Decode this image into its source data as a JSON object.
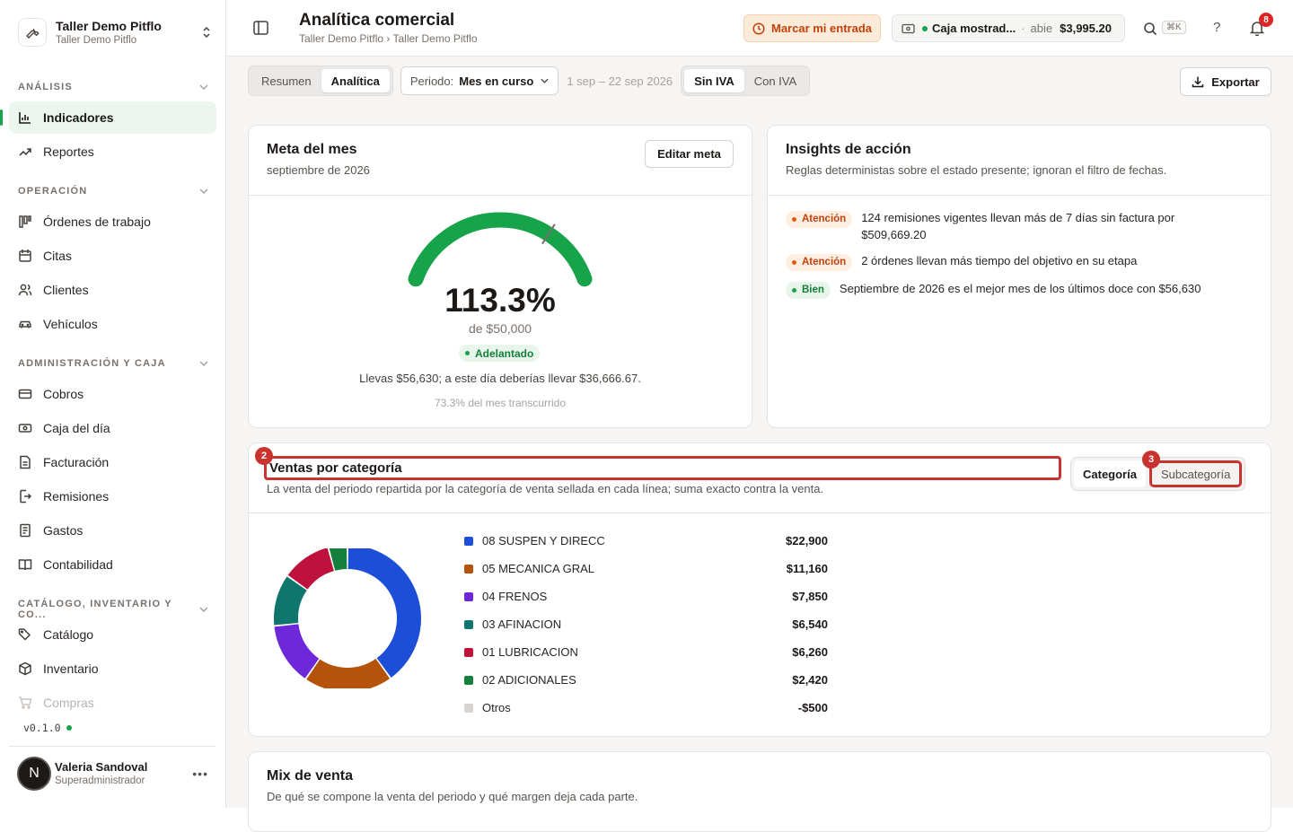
{
  "sidebar": {
    "org_name": "Taller Demo Pitflo",
    "org_sub": "Taller Demo Pitflo",
    "sections": {
      "analysis": "ANÁLISIS",
      "operation": "OPERACIÓN",
      "admin": "ADMINISTRACIÓN Y CAJA",
      "catalog": "CATÁLOGO, INVENTARIO Y CO..."
    },
    "items": {
      "indicadores": "Indicadores",
      "reportes": "Reportes",
      "ordenes": "Órdenes de trabajo",
      "citas": "Citas",
      "clientes": "Clientes",
      "vehiculos": "Vehículos",
      "cobros": "Cobros",
      "caja": "Caja del día",
      "facturacion": "Facturación",
      "remisiones": "Remisiones",
      "gastos": "Gastos",
      "contabilidad": "Contabilidad",
      "catalogo": "Catálogo",
      "inventario": "Inventario",
      "compras": "Compras"
    },
    "version": "v0.1.0",
    "user": {
      "initial": "N",
      "name": "Valeria Sandoval",
      "role": "Superadministrador"
    }
  },
  "header": {
    "title": "Analítica comercial",
    "breadcrumb": "Taller Demo Pitflo › Taller Demo Pitflo",
    "entry_button": "Marcar mi entrada",
    "cash": {
      "name": "Caja mostrad...",
      "sep": "·",
      "status": "abie",
      "amount": "$3,995.20"
    },
    "shortcut": "⌘K",
    "help": "?",
    "notifications": "8"
  },
  "toolbar": {
    "tabs": [
      "Resumen",
      "Analítica"
    ],
    "period_label": "Periodo:",
    "period_value": "Mes en curso",
    "date_range": "1 sep – 22 sep 2026",
    "tax_tabs": [
      "Sin IVA",
      "Con IVA"
    ],
    "export": "Exportar"
  },
  "goal": {
    "title": "Meta del mes",
    "subtitle": "septiembre de 2026",
    "edit": "Editar meta",
    "percent": "113.3%",
    "of": "de $50,000",
    "status": "Adelantado",
    "progress": 1.133,
    "expected": 0.733,
    "line": "Llevas $56,630; a este día deberías llevar $36,666.67.",
    "elapsed": "73.3% del mes transcurrido"
  },
  "insights": {
    "title": "Insights de acción",
    "subtitle": "Reglas deterministas sobre el estado presente; ignoran el filtro de fechas.",
    "rows": [
      {
        "tag": "Atención",
        "text": "124 remisiones vigentes llevan más de 7 días sin factura por $509,669.20"
      },
      {
        "tag": "Atención",
        "text": "2 órdenes llevan más tiempo del objetivo en su etapa"
      },
      {
        "tag": "Bien",
        "text": "Septiembre de 2026 es el mejor mes de los últimos doce con $56,630"
      }
    ]
  },
  "sales": {
    "title": "Ventas por categoría",
    "subtitle": "La venta del periodo repartida por la categoría de venta sellada en cada línea; suma exacto contra la venta.",
    "toggle": [
      "Categoría",
      "Subcategoría"
    ],
    "markers": [
      "2",
      "3"
    ]
  },
  "chart_data": {
    "type": "pie",
    "categories": [
      "08 SUSPEN Y DIRECC",
      "05 MECANICA GRAL",
      "04 FRENOS",
      "03 AFINACION",
      "01 LUBRICACION",
      "02 ADICIONALES",
      "Otros"
    ],
    "values": [
      22900,
      11160,
      7850,
      6540,
      6260,
      2420,
      -500
    ],
    "labels": [
      "$22,900",
      "$11,160",
      "$7,850",
      "$6,540",
      "$6,260",
      "$2,420",
      "-$500"
    ],
    "colors": [
      "#1d4ed8",
      "#b45309",
      "#6d28d9",
      "#0f766e",
      "#be123c",
      "#15803d",
      "#d6d3d1"
    ]
  },
  "mix": {
    "title": "Mix de venta",
    "subtitle": "De qué se compone la venta del periodo y qué margen deja cada parte."
  }
}
